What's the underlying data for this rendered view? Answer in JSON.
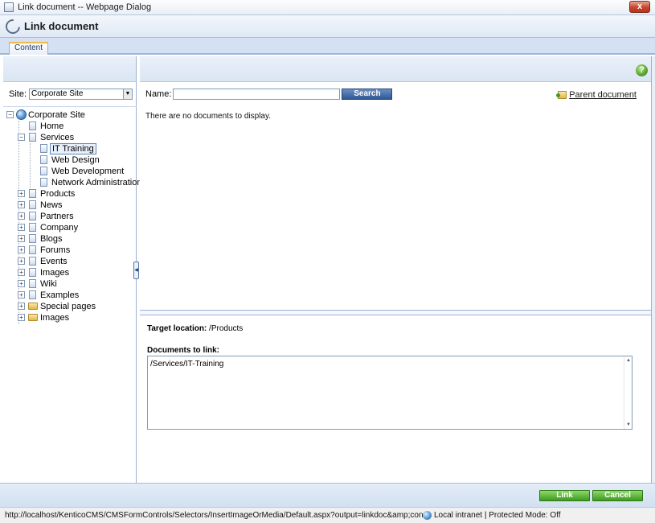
{
  "window": {
    "title": "Link document -- Webpage Dialog",
    "close_glyph": "x"
  },
  "header": {
    "title": "Link document"
  },
  "tabs": [
    {
      "label": "Content",
      "active": true
    }
  ],
  "left": {
    "site_label": "Site:",
    "site_value": "Corporate Site",
    "tree": [
      {
        "label": "Corporate Site",
        "type": "globe",
        "expanded": true,
        "level": 0
      },
      {
        "label": "Home",
        "type": "doc",
        "level": 1
      },
      {
        "label": "Services",
        "type": "doc",
        "expanded": true,
        "level": 1
      },
      {
        "label": "IT Training",
        "type": "doc",
        "level": 2,
        "selected": true
      },
      {
        "label": "Web Design",
        "type": "doc",
        "level": 2
      },
      {
        "label": "Web Development",
        "type": "doc",
        "level": 2
      },
      {
        "label": "Network Administration",
        "type": "doc",
        "level": 2
      },
      {
        "label": "Products",
        "type": "doc",
        "expanded": false,
        "level": 1
      },
      {
        "label": "News",
        "type": "doc",
        "expanded": false,
        "level": 1
      },
      {
        "label": "Partners",
        "type": "doc",
        "expanded": false,
        "level": 1
      },
      {
        "label": "Company",
        "type": "doc",
        "expanded": false,
        "level": 1
      },
      {
        "label": "Blogs",
        "type": "doc",
        "expanded": false,
        "level": 1
      },
      {
        "label": "Forums",
        "type": "doc",
        "expanded": false,
        "level": 1
      },
      {
        "label": "Events",
        "type": "doc",
        "expanded": false,
        "level": 1
      },
      {
        "label": "Images",
        "type": "doc",
        "expanded": false,
        "level": 1
      },
      {
        "label": "Wiki",
        "type": "doc",
        "expanded": false,
        "level": 1
      },
      {
        "label": "Examples",
        "type": "doc",
        "expanded": false,
        "level": 1
      },
      {
        "label": "Special pages",
        "type": "folder",
        "expanded": false,
        "level": 1
      },
      {
        "label": "Images",
        "type": "folder",
        "expanded": false,
        "level": 1
      }
    ]
  },
  "right": {
    "name_label": "Name:",
    "name_value": "",
    "search_label": "Search",
    "parent_label": "Parent document",
    "empty_message": "There are no documents to display.",
    "target_label": "Target location:",
    "target_value": "/Products",
    "docs_label": "Documents to link:",
    "docs_value": "/Services/IT-Training"
  },
  "footer": {
    "link_label": "Link",
    "cancel_label": "Cancel"
  },
  "statusbar": {
    "url": "http://localhost/KenticoCMS/CMSFormControls/Selectors/InsertImageOrMedia/Default.aspx?output=linkdoc&amp;content_site=CorporateS",
    "zone": "Local intranet | Protected Mode: Off"
  },
  "colors": {
    "accent_blue": "#2f5894",
    "button_green": "#3d9b1f",
    "tab_highlight": "#f3b84a"
  }
}
